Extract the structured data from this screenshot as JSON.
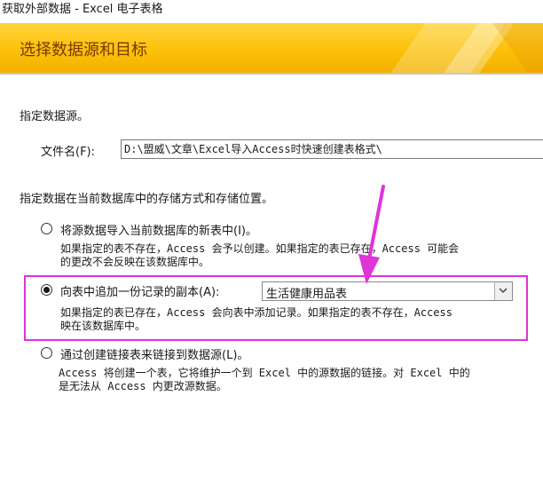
{
  "window": {
    "title": "获取外部数据 - Excel 电子表格"
  },
  "banner": {
    "heading": "选择数据源和目标"
  },
  "source": {
    "section_label": "指定数据源。",
    "file_label": "文件名(F):",
    "file_value": "D:\\盟威\\文章\\Excel导入Access时快速创建表格式\\"
  },
  "storage": {
    "section_label": "指定数据在当前数据库中的存储方式和存储位置。"
  },
  "options": [
    {
      "label": "将源数据导入当前数据库的新表中(I)。",
      "desc1": "如果指定的表不存在，Access 会予以创建。如果指定的表已存在，Access 可能会",
      "desc2": "的更改不会反映在该数据库中。",
      "selected": false
    },
    {
      "label": "向表中追加一份记录的副本(A):",
      "desc1": "如果指定的表已存在，Access 会向表中添加记录。如果指定的表不存在，Access",
      "desc2": "映在该数据库中。",
      "selected": true,
      "combo_value": "生活健康用品表"
    },
    {
      "label": "通过创建链接表来链接到数据源(L)。",
      "desc1": "Access 将创建一个表，它将维护一个到 Excel 中的源数据的链接。对 Excel 中的",
      "desc2": "是无法从 Access 内更改源数据。",
      "selected": false
    }
  ],
  "colors": {
    "banner": "#fcc10a",
    "annotation": "#e033d8"
  }
}
